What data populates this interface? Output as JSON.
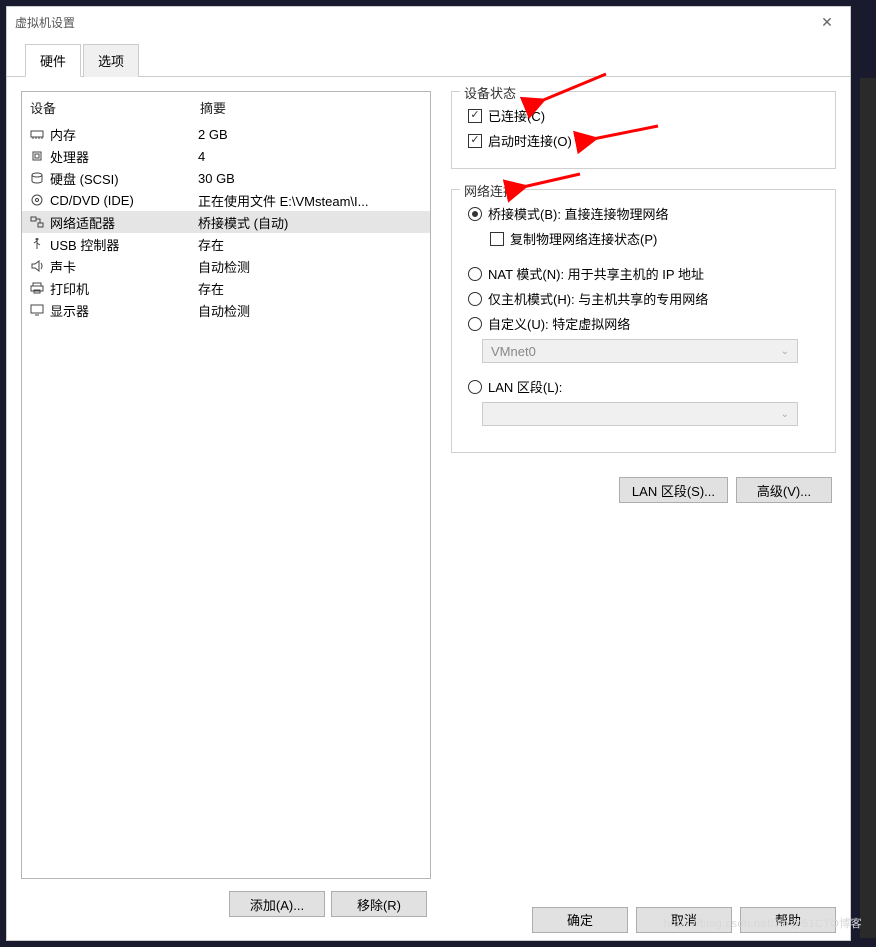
{
  "window": {
    "title": "虚拟机设置"
  },
  "tabs": {
    "hardware": "硬件",
    "options": "选项"
  },
  "device_list": {
    "header_device": "设备",
    "header_summary": "摘要",
    "rows": [
      {
        "icon": "memory-icon",
        "name": "内存",
        "summary": "2 GB"
      },
      {
        "icon": "cpu-icon",
        "name": "处理器",
        "summary": "4"
      },
      {
        "icon": "disk-icon",
        "name": "硬盘 (SCSI)",
        "summary": "30 GB"
      },
      {
        "icon": "cd-icon",
        "name": "CD/DVD (IDE)",
        "summary": "正在使用文件 E:\\VMsteam\\I..."
      },
      {
        "icon": "network-icon",
        "name": "网络适配器",
        "summary": "桥接模式 (自动)"
      },
      {
        "icon": "usb-icon",
        "name": "USB 控制器",
        "summary": "存在"
      },
      {
        "icon": "sound-icon",
        "name": "声卡",
        "summary": "自动检测"
      },
      {
        "icon": "printer-icon",
        "name": "打印机",
        "summary": "存在"
      },
      {
        "icon": "display-icon",
        "name": "显示器",
        "summary": "自动检测"
      }
    ],
    "selected_index": 4
  },
  "buttons": {
    "add": "添加(A)...",
    "remove": "移除(R)",
    "lan_segments": "LAN 区段(S)...",
    "advanced": "高级(V)...",
    "ok": "确定",
    "cancel": "取消",
    "help": "帮助"
  },
  "device_status": {
    "legend": "设备状态",
    "connected": {
      "label": "已连接(C)",
      "checked": true
    },
    "connect_at_power_on": {
      "label": "启动时连接(O)",
      "checked": true
    }
  },
  "network_connection": {
    "legend": "网络连接",
    "bridged": {
      "label": "桥接模式(B): 直接连接物理网络",
      "selected": true
    },
    "replicate": {
      "label": "复制物理网络连接状态(P)",
      "checked": false
    },
    "nat": {
      "label": "NAT 模式(N): 用于共享主机的 IP 地址",
      "selected": false
    },
    "hostonly": {
      "label": "仅主机模式(H): 与主机共享的专用网络",
      "selected": false
    },
    "custom": {
      "label": "自定义(U): 特定虚拟网络",
      "selected": false
    },
    "custom_value": "VMnet0",
    "lan_segment": {
      "label": "LAN 区段(L):",
      "selected": false
    },
    "lan_value": ""
  },
  "watermark": "https://blog.csdn.net/Jar@51CTO博客"
}
